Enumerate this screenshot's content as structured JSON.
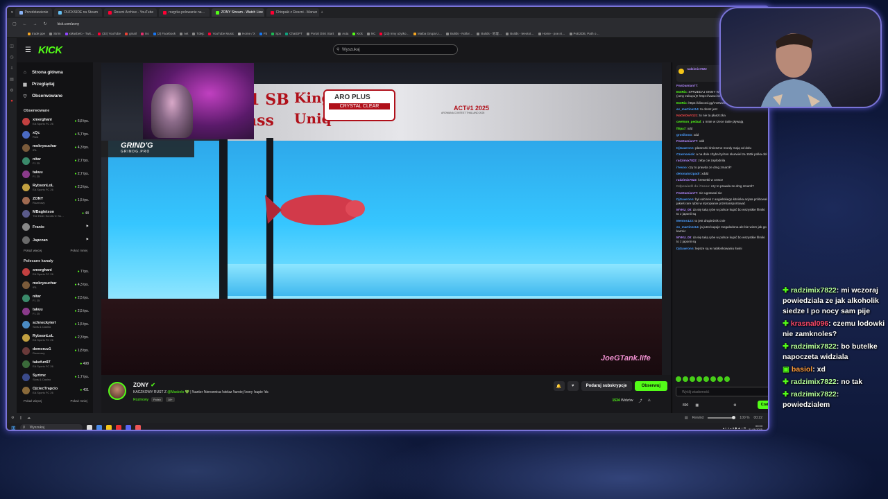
{
  "browser": {
    "tabs": [
      {
        "label": "Przedstawienie",
        "color": "#8ab4f8",
        "active": false
      },
      {
        "label": "DUCKSIDE na Steam",
        "color": "#66c0f4",
        "active": false
      },
      {
        "label": "Reszni Archive - YouTube",
        "color": "#ff0033",
        "active": false
      },
      {
        "label": "rozgrka polowanie na…",
        "color": "#ff0033",
        "active": false
      },
      {
        "label": "ZONY Stream - Watch Live",
        "color": "#53fc18",
        "active": true
      },
      {
        "label": "Chinpaki z Reszni - Manun",
        "color": "#ff0033",
        "active": false
      }
    ],
    "new_tab": "+",
    "url": "kick.com/zony",
    "bookmarks": [
      {
        "label": "trade ppe",
        "color": "#f5a623"
      },
      {
        "label": "Strim",
        "color": "#888888"
      },
      {
        "label": "xMasbelo - Twit…",
        "color": "#9146ff"
      },
      {
        "label": "(33) YouTube",
        "color": "#ff0033"
      },
      {
        "label": "gmail",
        "color": "#ea4335"
      },
      {
        "label": "ins",
        "color": "#e1306c"
      },
      {
        "label": "(2) Facebook",
        "color": "#1877f2"
      },
      {
        "label": "net",
        "color": "#888888"
      },
      {
        "label": "Tdejc",
        "color": "#888888"
      },
      {
        "label": "YouTube Music",
        "color": "#ff0033"
      },
      {
        "label": "Home / X",
        "color": "#aaaaaa"
      },
      {
        "label": "Fb",
        "color": "#1877f2"
      },
      {
        "label": "Spo",
        "color": "#1db954"
      },
      {
        "label": "ChatGPT",
        "color": "#10a37f"
      },
      {
        "label": "Portal OSK Start",
        "color": "#888888"
      },
      {
        "label": "Auta",
        "color": "#888888"
      },
      {
        "label": "Kick",
        "color": "#53fc18"
      },
      {
        "label": "NC",
        "color": "#888888"
      },
      {
        "label": "(23) Inny użytko…",
        "color": "#ff0033"
      },
      {
        "label": "Maiba Grupa U…",
        "color": "#f5a623"
      },
      {
        "label": "Builds - Nollor…",
        "color": "#888888"
      },
      {
        "label": "Builds - 地理…",
        "color": "#888888"
      },
      {
        "label": "Builds - teeotot…",
        "color": "#888888"
      },
      {
        "label": "Home - poe.ni…",
        "color": "#888888"
      },
      {
        "label": "PoE2DB, Path o…",
        "color": "#888888"
      }
    ]
  },
  "kick": {
    "logo": "KICK",
    "search_placeholder": "Wyszukaj",
    "nav": [
      {
        "label": "Strona główna",
        "icon": "⌂"
      },
      {
        "label": "Przeglądaj",
        "icon": "▦"
      },
      {
        "label": "Obserwowane",
        "icon": "♡"
      }
    ],
    "followed_header": "Obserwowane",
    "followed": [
      {
        "name": "xmerghani",
        "game": "EA Sports FC 26",
        "viewers": "6,8 tys.",
        "color": "#c24040"
      },
      {
        "name": "xQc",
        "game": "Rust",
        "viewers": "5,7 tys.",
        "color": "#4a6ac2"
      },
      {
        "name": "mokrysuchar",
        "game": "IRL",
        "viewers": "4,3 tys.",
        "color": "#7a5a3a"
      },
      {
        "name": "nitar",
        "game": "F1 25",
        "viewers": "2,7 tys.",
        "color": "#3a8a6a"
      },
      {
        "name": "takuu",
        "game": "F1 25",
        "viewers": "2,7 tys.",
        "color": "#8a3a8a"
      },
      {
        "name": "RybsonLoL",
        "game": "EA Sports FC 26",
        "viewers": "2,3 tys.",
        "color": "#c2a040"
      },
      {
        "name": "ZONY",
        "game": "Rozmowy",
        "viewers": "1,5 tys.",
        "color": "#a06a50"
      },
      {
        "name": "MBagletson",
        "game": "The Elder Scrolls V: Sk…",
        "viewers": "48",
        "color": "#5a5a8a"
      },
      {
        "name": "Franio",
        "game": "",
        "viewers": "",
        "color": "#888888"
      },
      {
        "name": "Japczan",
        "game": "",
        "viewers": "",
        "color": "#6a6a6a"
      }
    ],
    "show_more": "Pokaż więcej",
    "show_less": "Pokaż mniej",
    "recommended_header": "Polecane kanały",
    "recommended": [
      {
        "name": "xmerghani",
        "game": "EA Sports FC 26",
        "viewers": "7 tys.",
        "color": "#c24040"
      },
      {
        "name": "mokrysuchar",
        "game": "IRL",
        "viewers": "4,3 tys.",
        "color": "#7a5a3a"
      },
      {
        "name": "nitar",
        "game": "F1 25",
        "viewers": "2,5 tys.",
        "color": "#3a8a6a"
      },
      {
        "name": "takuu",
        "game": "F1 25",
        "viewers": "2,5 tys.",
        "color": "#8a3a8a"
      },
      {
        "name": "schneckyierl",
        "game": "Slots & Casino",
        "viewers": "1,5 tys.",
        "color": "#4a8ac2"
      },
      {
        "name": "RybsonLoL",
        "game": "EA Sports FC 26",
        "viewers": "2,3 tys.",
        "color": "#c2a040"
      },
      {
        "name": "demonzz1",
        "game": "Rozmowy",
        "viewers": "1,8 tys.",
        "color": "#6a3a3a"
      },
      {
        "name": "takefun97",
        "game": "EA Sports FC 26",
        "viewers": "498",
        "color": "#3a6a3a"
      },
      {
        "name": "Syztmz",
        "game": "Slots & Casino",
        "viewers": "1,7 tys.",
        "color": "#3a4a8a"
      },
      {
        "name": "OjciecTrapcio",
        "game": "EA Sports FC 26",
        "viewers": "401",
        "color": "#8a6a3a"
      }
    ]
  },
  "video": {
    "banner_line1": "01 SB",
    "banner_line2": "Class",
    "banner_word1": "King",
    "banner_word2": "Uniq",
    "brand": "ARO PLUS",
    "brand_sub": "CRYSTAL CLEAR",
    "event": "ACT#1 2025",
    "event_sub": "AROWANA CONTEST THAILAND 2025",
    "overlay_brand": "GRIND'G",
    "overlay_brand_sub": "GRINDG.PRO",
    "watermark": "JoeGTank.life"
  },
  "stream": {
    "streamer": "ZONY",
    "title_prefix": "KACZKOWY RUST Z",
    "title_mention": "@Masbelo",
    "title_suffix": "💚 | !kantor !kierownica !stelaz !turniej !zony !supie !dc",
    "category": "Rozmowy",
    "tags": [
      "Polish",
      "18+"
    ],
    "subscribe_label": "Podaruj subskrypcje",
    "follow_label": "Obserwuj",
    "viewers_label": "Widzów",
    "viewers_count": "1534"
  },
  "chat": {
    "pinned_user": "radzimix7822",
    "messages": [
      {
        "user": "PanDamian77",
        "text": "",
        "color": "#b388ff"
      },
      {
        "user": "BotRix",
        "text": "SPRZEDAJ SKINY W NAJLEPSZYM KANTORZE (ceny zakupu)!! https://www.instagram.com/zonyskins",
        "color": "#53fc18"
      },
      {
        "user": "BotRix",
        "text": "https://discord.gg/VU9w29ENSC",
        "color": "#53fc18"
      },
      {
        "user": "ex_martinez14",
        "text": "to dorsz jest",
        "color": "#4a9eff"
      },
      {
        "user": "NoOnOwY121",
        "text": "to nie ta płaszczka",
        "color": "#ff4a4a"
      },
      {
        "user": "cwelson_pedaal",
        "text": "u mnie w rzece takie pływają",
        "color": "#53fc18"
      },
      {
        "user": "filipa7",
        "text": "xdd",
        "color": "#53fc18"
      },
      {
        "user": "grosikooo",
        "text": "xdd",
        "color": "#4a9eff"
      },
      {
        "user": "PanDamian77",
        "text": "xdd",
        "color": "#b388ff"
      },
      {
        "user": "DjGawronn",
        "text": "płaszczki śmieszne mordy mają od dołu",
        "color": "#4a9eff"
      },
      {
        "user": "Czarnowiok",
        "text": "a na dole chyba był ten skurwiel za 150k polka dol",
        "color": "#4a9eff"
      },
      {
        "user": "radzimix7822",
        "text": "zeby cie zaplodnila",
        "color": "#b388ff"
      },
      {
        "user": "iYesoo",
        "text": "czy to prawda ze dmg zmarzł?",
        "color": "#4a9eff"
      },
      {
        "user": "detonator2padr",
        "text": "xddd",
        "color": "#4a9eff"
      },
      {
        "user": "radzimix7822",
        "text": "krewetki w cewce",
        "color": "#b388ff"
      },
      {
        "user": "Ddpowiedź do iYesoo",
        "text": "czy to prawda ze dmg zmarzł?",
        "color": "#777777"
      },
      {
        "user": "PanDamian77",
        "text": "nie ugotowal sie",
        "color": "#b388ff"
      },
      {
        "user": "DjGawronn",
        "text": "był odcinek z angielskiego kitniska acjata próbował jakieś rare rybki w styropianie przetransportować",
        "color": "#4a9eff"
      },
      {
        "user": "MYKU_00",
        "text": "da się taką rybe w polsce kupić bo wszystkie filmiki to z japonii są",
        "color": "#b388ff"
      },
      {
        "user": "Mentos123",
        "text": "to jest drapieżnik cnie",
        "color": "#4a9eff"
      },
      {
        "user": "ex_martinez14",
        "text": "ja jutro kupuje megalodona ale bie wiem jak go karmic",
        "color": "#4a9eff"
      },
      {
        "user": "MYKU_00",
        "text": "da się taką rybe w polsce kupić bo wszystkie filmiki to z japonii są",
        "color": "#b388ff"
      },
      {
        "user": "DjGawronn",
        "text": "lepsze są w nabłonkowaniu świni",
        "color": "#4a9eff"
      }
    ],
    "input_placeholder": "Wyślij wiadomość",
    "points": "890",
    "send_label": "Czat"
  },
  "status": {
    "left": "◎",
    "quality": "Rewind",
    "volume": "100 %",
    "time": "00:22"
  },
  "taskbar": {
    "search": "Wyszukaj",
    "time": "00:03",
    "date": "21.09.2025"
  },
  "overlay_chat": [
    {
      "user": "radzimix7822",
      "text": ": mi wczoraj powiedziala ze jak alkoholik siedze I po nocy sam pije",
      "style": "u",
      "badge": "✚"
    },
    {
      "user": "krasnal096",
      "text": ": czemu lodowki nie zamknoles?",
      "style": "u2",
      "badge": "✚"
    },
    {
      "user": "radzimix7822",
      "text": ": bo butelke napoczeta widziala",
      "style": "u",
      "badge": "✚"
    },
    {
      "user": "basiol",
      "text": ": xd",
      "style": "u3",
      "badge": "▣"
    },
    {
      "user": "radzimix7822",
      "text": ": no tak",
      "style": "u",
      "badge": "✚"
    },
    {
      "user": "radzimix7822",
      "text": ": powiedzialem",
      "style": "u",
      "badge": "✚"
    }
  ]
}
